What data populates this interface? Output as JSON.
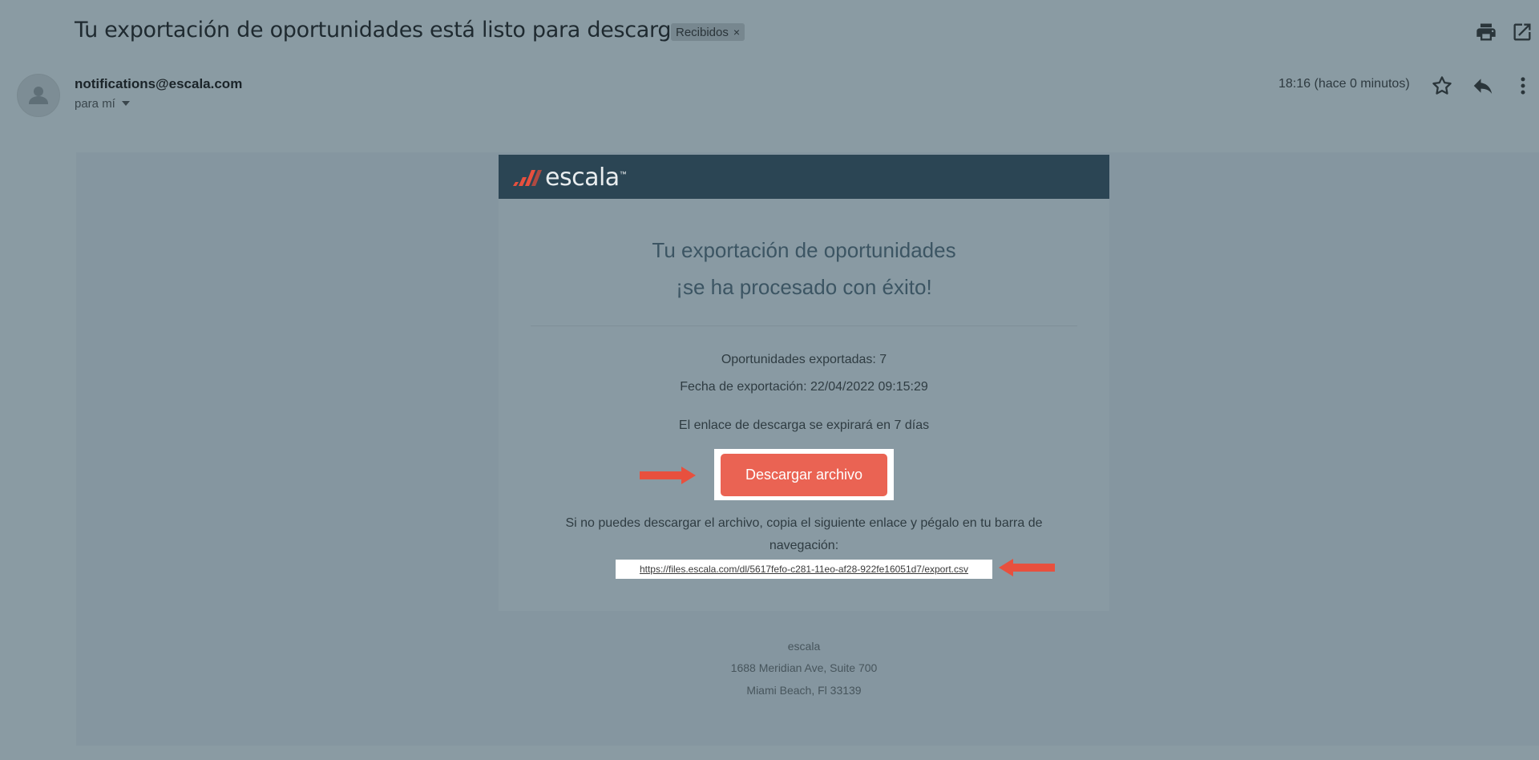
{
  "email": {
    "subject": "Tu exportación de oportunidades está listo para descargar",
    "label": "Recibidos",
    "label_close": "×",
    "sender": "notifications@escala.com",
    "to": "para mí",
    "time": "18:16 (hace 0 minutos)"
  },
  "icons": {
    "print": "print-icon",
    "open_new_window": "open-in-new-window-icon",
    "avatar": "person-icon",
    "star": "star-icon",
    "reply": "reply-icon",
    "more": "more-vert-icon",
    "to_caret": "chevron-down-icon"
  },
  "message": {
    "brand": "escala",
    "brand_mark": "™",
    "headline_line1": "Tu exportación de oportunidades",
    "headline_line2": "¡se ha procesado con éxito!",
    "exported_count": "Oportunidades exportadas: 7",
    "export_date": "Fecha de exportación: 22/04/2022 09:15:29",
    "expiry": "El enlace de descarga se expirará en 7 días",
    "download_button": "Descargar archivo",
    "fallback_line1": "Si no puedes descargar el archivo, copia el siguiente enlace y pégalo en tu barra de",
    "fallback_line2": "navegación:",
    "download_link": "https://files.escala.com/dl/5617fefo-c281-11eo-af28-922fe16051d7/export.csv"
  },
  "footer": {
    "company": "escala",
    "address": "1688 Meridian Ave, Suite 700",
    "city": "Miami Beach, Fl 33139"
  },
  "colors": {
    "overlay": "#8a9ba3",
    "brand_bar": "#2b4554",
    "button": "#ea6353",
    "annotation_arrow": "#e8503e"
  }
}
